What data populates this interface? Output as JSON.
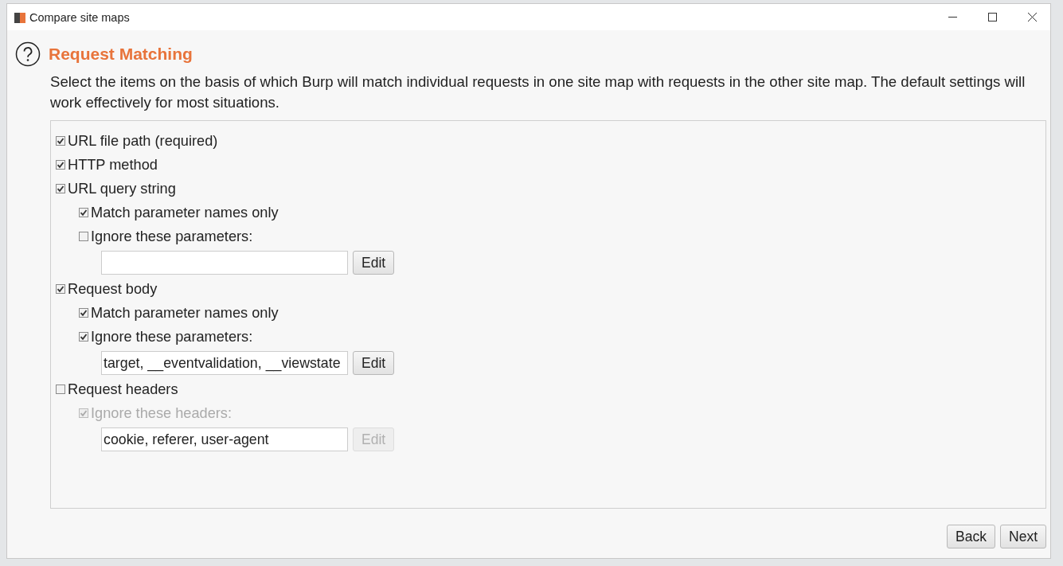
{
  "window": {
    "title": "Compare site maps"
  },
  "heading": "Request Matching",
  "description": "Select the items on the basis of which Burp will match individual requests in one site map with requests in the other site map. The default settings will work effectively for most situations.",
  "options": [
    {
      "kind": "checkbox",
      "label": "URL file path (required)",
      "checked": true,
      "disabled": false
    },
    {
      "kind": "checkbox",
      "label": "HTTP method",
      "checked": true,
      "disabled": false
    },
    {
      "kind": "checkbox",
      "label": "URL query string",
      "checked": true,
      "disabled": false,
      "children": [
        {
          "kind": "checkbox",
          "label": "Match parameter names only",
          "checked": true,
          "disabled": false
        },
        {
          "kind": "checkbox",
          "label": "Ignore these parameters:",
          "checked": false,
          "disabled": false,
          "children": [
            {
              "kind": "field",
              "button": "Edit",
              "disabled": false
            }
          ]
        }
      ]
    },
    {
      "kind": "checkbox",
      "label": "Request body",
      "checked": true,
      "disabled": false,
      "children": [
        {
          "kind": "checkbox",
          "label": "Match parameter names only",
          "checked": true,
          "disabled": false
        },
        {
          "kind": "checkbox",
          "label": "Ignore these parameters:",
          "checked": true,
          "disabled": false,
          "children": [
            {
              "kind": "field",
              "value": "target, __eventvalidation, __viewstate",
              "button": "Edit",
              "disabled": false
            }
          ]
        }
      ]
    },
    {
      "kind": "checkbox",
      "label": "Request headers",
      "checked": false,
      "disabled": false,
      "children": [
        {
          "kind": "checkbox",
          "label": "Ignore these headers:",
          "checked": true,
          "disabled": true,
          "children": [
            {
              "kind": "field",
              "value": "cookie, referer, user-agent",
              "button": "Edit",
              "disabled": true
            }
          ]
        }
      ]
    }
  ],
  "buttons": [
    "Back",
    "Next"
  ]
}
